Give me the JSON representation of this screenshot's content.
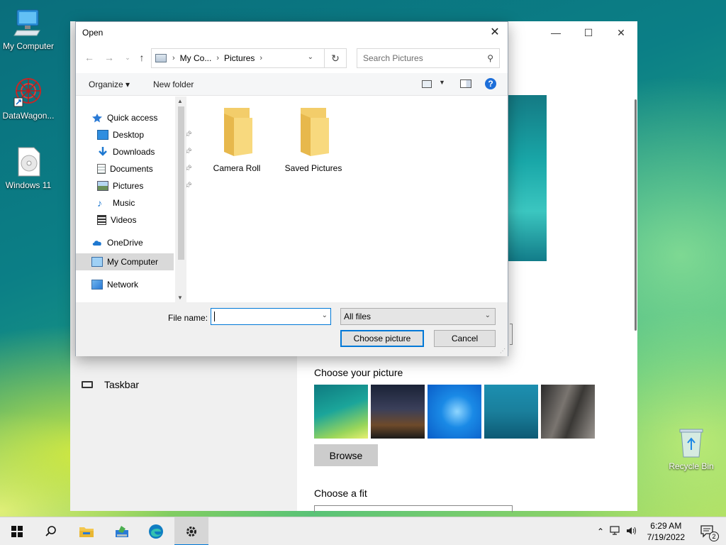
{
  "desktop": {
    "icons": [
      {
        "label": "My Computer"
      },
      {
        "label": "DataWagon..."
      },
      {
        "label": "Windows 11"
      },
      {
        "label": "Recycle Bin"
      }
    ]
  },
  "settings_window": {
    "nav_taskbar": "Taskbar",
    "choose_picture": "Choose your picture",
    "browse": "Browse",
    "choose_fit": "Choose a fit",
    "minimize": "—",
    "maximize": "☐",
    "close": "✕"
  },
  "dialog": {
    "title": "Open",
    "close": "✕",
    "breadcrumb": [
      "My Co...",
      "Pictures"
    ],
    "search_placeholder": "Search Pictures",
    "toolbar": {
      "organize": "Organize ▾",
      "new_folder": "New folder"
    },
    "nav": {
      "quick_access": "Quick access",
      "desktop": "Desktop",
      "downloads": "Downloads",
      "documents": "Documents",
      "pictures": "Pictures",
      "music": "Music",
      "videos": "Videos",
      "onedrive": "OneDrive",
      "my_computer": "My Computer",
      "network": "Network"
    },
    "folders": [
      {
        "name": "Camera Roll"
      },
      {
        "name": "Saved Pictures"
      }
    ],
    "file_name_label": "File name:",
    "file_name_value": "",
    "file_type": "All files",
    "choose_button": "Choose picture",
    "cancel_button": "Cancel"
  },
  "taskbar": {
    "time": "6:29 AM",
    "date": "7/19/2022",
    "notification_count": "2"
  }
}
